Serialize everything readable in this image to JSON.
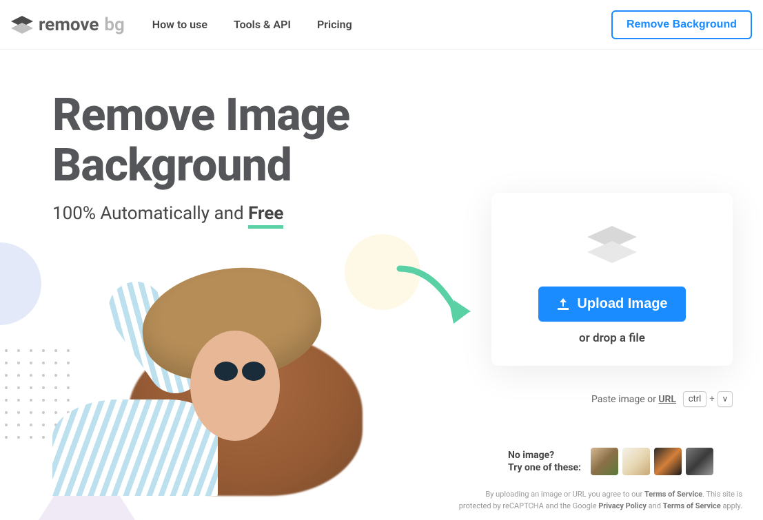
{
  "header": {
    "logo_main": "remove",
    "logo_suffix": "bg",
    "nav": [
      "How to use",
      "Tools & API",
      "Pricing"
    ],
    "cta": "Remove Background"
  },
  "hero": {
    "title_line1": "Remove Image",
    "title_line2": "Background",
    "subtitle_prefix": "100% Automatically and ",
    "subtitle_free": "Free"
  },
  "upload": {
    "button": "Upload Image",
    "drop": "or drop a file",
    "paste_prefix": "Paste image or ",
    "paste_url": "URL",
    "kbd1": "ctrl",
    "kbd_plus": "+",
    "kbd2": "v"
  },
  "samples": {
    "line1": "No image?",
    "line2": "Try one of these:"
  },
  "legal": {
    "l1_a": "By uploading an image or URL you agree to our ",
    "l1_b": "Terms of Service",
    "l1_c": ". This site is",
    "l2_a": "protected by reCAPTCHA and the Google ",
    "l2_b": "Privacy Policy",
    "l2_c": " and ",
    "l2_d": "Terms of Service",
    "l2_e": " apply."
  }
}
